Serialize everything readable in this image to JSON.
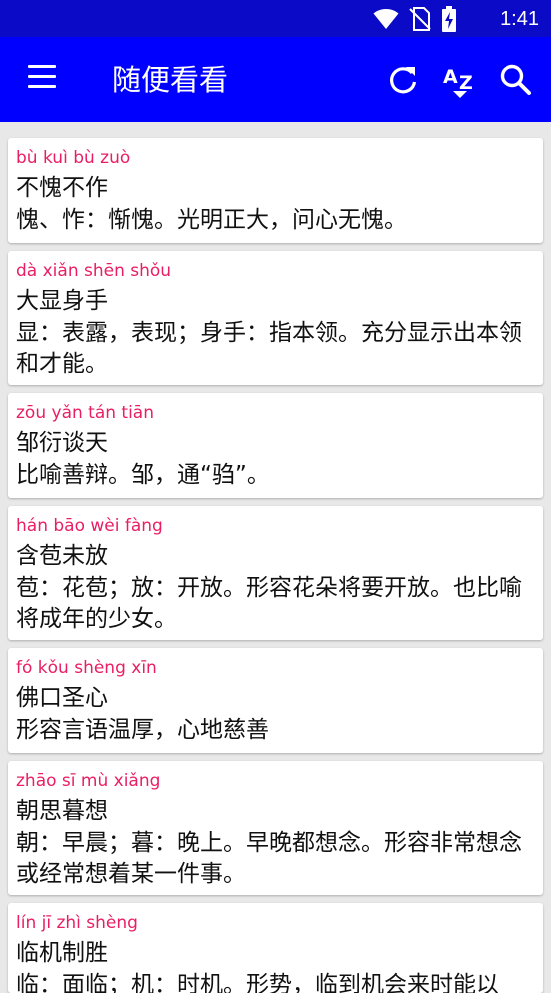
{
  "status_bar": {
    "time": "1:41",
    "icons": [
      "wifi-icon",
      "no-sim-icon",
      "battery-charging-icon"
    ]
  },
  "app_bar": {
    "title": "随便看看",
    "actions": [
      "menu-icon",
      "refresh-icon",
      "sort-az-icon",
      "search-icon"
    ]
  },
  "idioms": [
    {
      "pinyin": "bù kuì bù zuò",
      "word": "不愧不作",
      "meaning": "愧、怍：惭愧。光明正大，问心无愧。"
    },
    {
      "pinyin": "dà xiǎn shēn shǒu",
      "word": "大显身手",
      "meaning": "显：表露，表现；身手：指本领。充分显示出本领和才能。"
    },
    {
      "pinyin": "zōu yǎn tán tiān",
      "word": "邹衍谈天",
      "meaning": "比喻善辩。邹，通“驺”。"
    },
    {
      "pinyin": "hán bāo wèi fàng",
      "word": "含苞未放",
      "meaning": "苞：花苞；放：开放。形容花朵将要开放。也比喻将成年的少女。"
    },
    {
      "pinyin": "fó kǒu shèng xīn",
      "word": "佛口圣心",
      "meaning": "形容言语温厚，心地慈善"
    },
    {
      "pinyin": "zhāo sī mù xiǎng",
      "word": "朝思暮想",
      "meaning": "朝：早晨；暮：晚上。早晚都想念。形容非常想念或经常想着某一件事。"
    },
    {
      "pinyin": "lín jī zhì shèng",
      "word": "临机制胜",
      "meaning": "临：面临；机：时机。形势，临到机会来时能以"
    }
  ]
}
